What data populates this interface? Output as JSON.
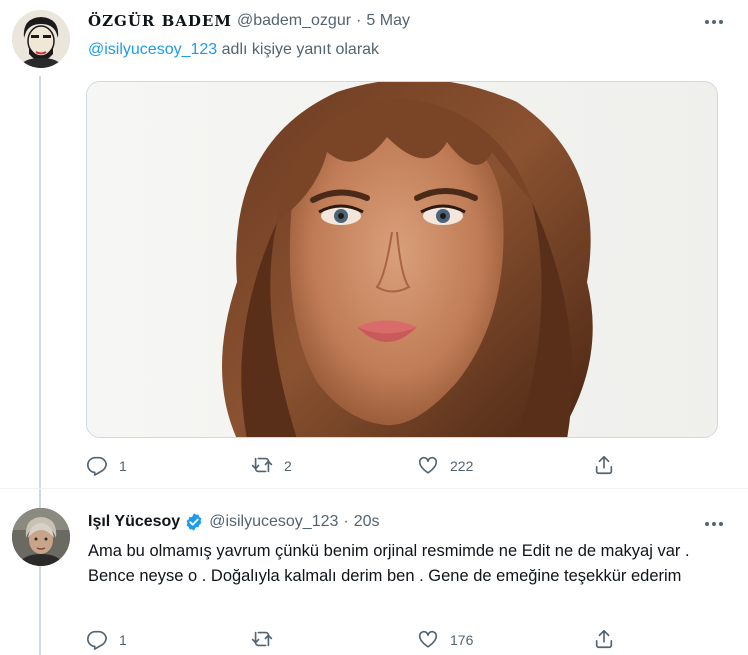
{
  "tweets": [
    {
      "author": {
        "name": "ÖZGÜR BADEM",
        "handle": "@badem_ozgur"
      },
      "dot": "·",
      "time": "5 May",
      "reply_to": {
        "mention": "@isilyucesoy_123",
        "suffix": " adlı kişiye yanıt olarak"
      },
      "media": {
        "kind": "photo",
        "alt": ""
      },
      "actions": {
        "reply": "1",
        "retweet": "2",
        "like": "222"
      }
    },
    {
      "author": {
        "name": "Işıl Yücesoy",
        "handle": "@isilyucesoy_123",
        "verified": true
      },
      "dot": "·",
      "time": "20s",
      "text": "Ama bu olmamış yavrum çünkü benim orjinal resmimde ne Edit ne de makyaj var . Bence neyse o . Doğalıyla kalmalı derim ben . Gene de emeğine teşekkür ederim",
      "actions": {
        "reply": "1",
        "retweet": "",
        "like": "176"
      }
    }
  ],
  "icons": {
    "reply": "reply-icon",
    "retweet": "retweet-icon",
    "like": "heart-icon",
    "share": "share-icon",
    "more": "more-icon",
    "verified": "verified-badge-icon"
  },
  "colors": {
    "text": "#0f1419",
    "secondary": "#536471",
    "link": "#1d9bf0",
    "verified": "#1d9bf0"
  }
}
